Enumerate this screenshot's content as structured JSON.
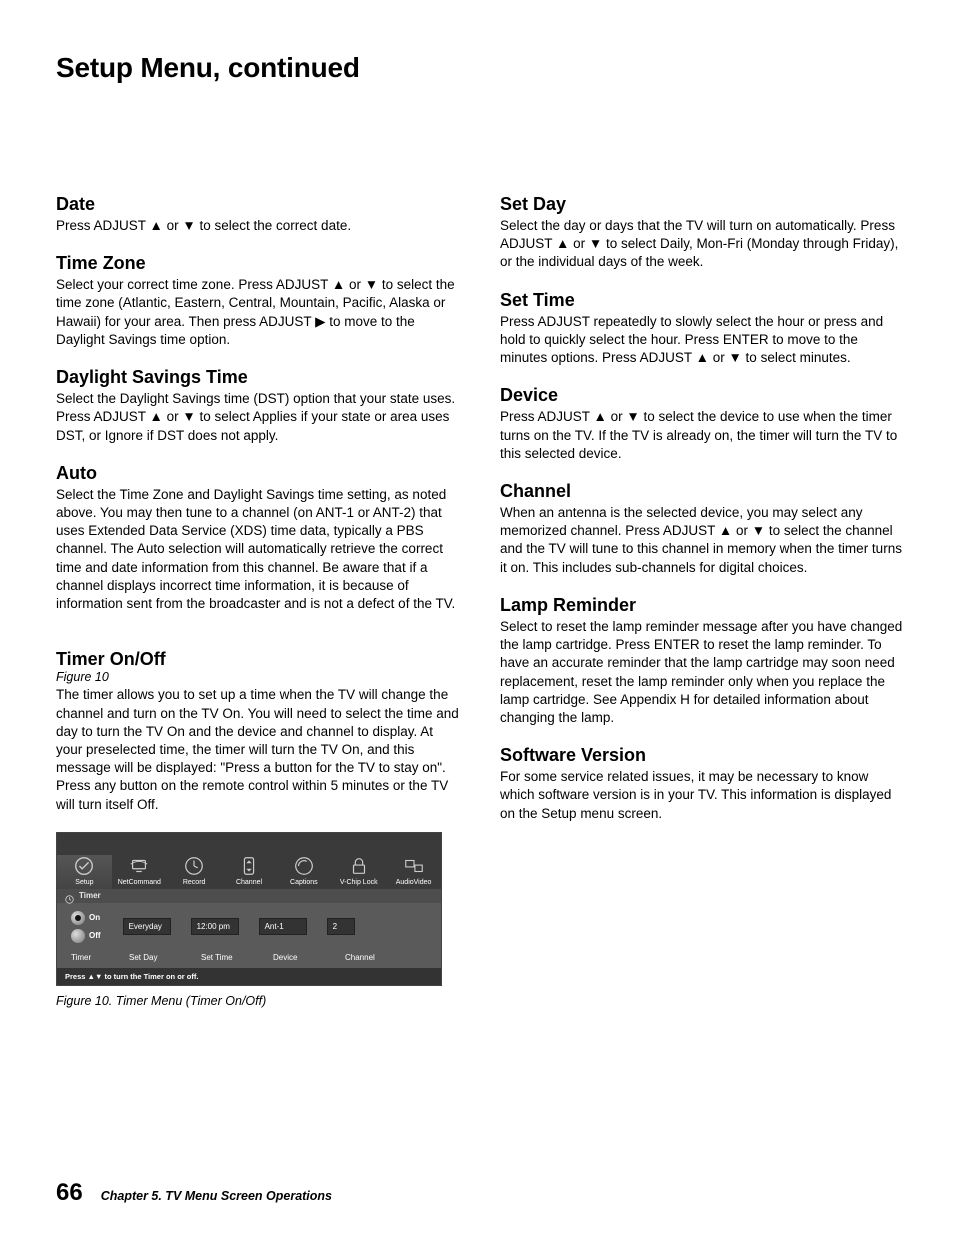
{
  "title": "Setup Menu, continued",
  "glyphs": {
    "up": "▲",
    "down": "▼",
    "right": "▶"
  },
  "left": {
    "date": {
      "h": "Date",
      "p": "Press ADJUST ▲ or ▼ to select the correct date."
    },
    "timezone": {
      "h": "Time Zone",
      "p": "Select your correct time zone.  Press ADJUST ▲ or ▼ to select the time zone (Atlantic, Eastern, Central, Mountain, Pacific, Alaska or Hawaii) for your area.  Then press ADJUST ▶  to move to the Daylight Savings time option."
    },
    "dst": {
      "h": "Daylight Savings Time",
      "p": "Select the Daylight Savings time (DST) option that your state uses.  Press ADJUST ▲ or ▼ to select Applies if your state or area uses DST, or Ignore if DST does not apply."
    },
    "auto": {
      "h": "Auto",
      "p": "Select the Time Zone and Daylight Savings time setting, as noted above.  You may then tune to a channel (on ANT-1 or ANT-2) that uses Extended Data Service (XDS) time data, typically a PBS channel.  The Auto selection will automatically retrieve the correct time and date information from this channel. Be aware that if a channel displays incorrect time information, it is because of information sent from the broadcaster and is not a defect of the TV."
    },
    "timer": {
      "h": "Timer On/Off",
      "figlabel": "Figure 10",
      "p": "The timer allows you to set up a time when the TV will change the channel and turn on the TV On.  You will need to select the time and day to turn the TV On and the device and channel to display.  At your preselected time, the timer will turn the TV On, and this message will be displayed: \"Press a button for the TV to stay on\".  Press any button on the remote control within 5 minutes or the TV will turn itself Off."
    },
    "figure": {
      "tabs": [
        "Setup",
        "NetCommand",
        "Record",
        "Channel",
        "Captions",
        "V-Chip Lock",
        "AudioVideo"
      ],
      "active_tab": 0,
      "submenu": "Timer",
      "radio_on": "On",
      "radio_off": "Off",
      "fields": {
        "day": "Everyday",
        "time": "12:00 pm",
        "device": "Ant-1",
        "channel": "2"
      },
      "col_labels": [
        "Timer",
        "Set Day",
        "Set Time",
        "Device",
        "Channel"
      ],
      "hint": "Press ▲▼ to turn the Timer on or off.",
      "caption": "Figure 10. Timer Menu (Timer On/Off)"
    }
  },
  "right": {
    "setday": {
      "h": "Set Day",
      "p": "Select the day or days that the TV will turn on automatically.  Press ADJUST ▲ or ▼ to select Daily, Mon-Fri (Monday through Friday), or the individual days of the week."
    },
    "settime": {
      "h": "Set Time",
      "p": "Press ADJUST  repeatedly to slowly select the hour or press and hold to quickly select the hour.  Press ENTER to move to the minutes options.  Press ADJUST ▲ or ▼ to select minutes."
    },
    "device": {
      "h": "Device",
      "p": "Press ADJUST ▲ or ▼ to select the device to use when the timer turns on the TV.  If the TV is already on, the timer will turn the TV to this selected device."
    },
    "channel": {
      "h": "Channel",
      "p": "When an antenna is the selected device, you may select any memorized channel.  Press ADJUST ▲ or ▼ to select the channel and the TV will tune to this channel in memory when the timer turns it on.  This includes sub-channels for digital choices."
    },
    "lamp": {
      "h": "Lamp Reminder",
      "p": "Select to reset the lamp reminder message after you have changed the lamp cartridge.  Press ENTER to reset the lamp reminder.  To have an accurate reminder that the lamp cartridge may soon need replacement, reset the lamp reminder only when you replace the lamp cartridge.  See Appendix H for detailed information about changing the lamp."
    },
    "software": {
      "h": "Software Version",
      "p": "For some service related issues, it may be necessary to know which software version is in your TV.  This information is displayed on the Setup menu screen."
    }
  },
  "footer": {
    "page": "66",
    "chapter": "Chapter 5. TV Menu Screen Operations"
  }
}
